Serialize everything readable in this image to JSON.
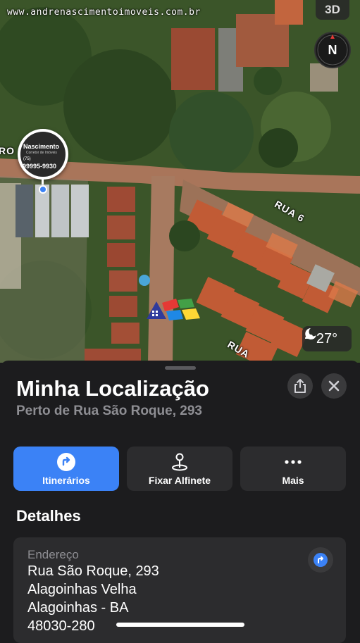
{
  "map": {
    "watermark": "www.andrenascimentoimoveis.com.br",
    "mode_button": "3D",
    "compass_letter": "N",
    "street_labels": [
      "RO",
      "RUA 6",
      "RUA"
    ],
    "pin": {
      "title": "Nascimento",
      "subtitle": "Corretor de Imóveis",
      "phone": "99995-9930",
      "prefix": "(75)"
    },
    "weather": {
      "icon": "moon-cloud-icon",
      "temperature": "27°"
    },
    "logo_colors": [
      "#2f3a9c",
      "#e53935",
      "#43a047",
      "#1e88e5",
      "#fdd835"
    ]
  },
  "sheet": {
    "title": "Minha Localização",
    "subtitle": "Perto de Rua São Roque, 293",
    "actions": [
      {
        "label": "Itinerários",
        "icon": "directions-icon"
      },
      {
        "label": "Fixar Alfinete",
        "icon": "pin-icon"
      },
      {
        "label": "Mais",
        "icon": "more-icon"
      }
    ],
    "details_heading": "Detalhes",
    "address": {
      "label": "Endereço",
      "lines": [
        "Rua São Roque, 293",
        "Alagoinhas Velha",
        "Alagoinhas - BA",
        "48030-280"
      ]
    }
  },
  "colors": {
    "accent": "#3b82f6",
    "sheet_bg": "#1c1c1e",
    "card_bg": "#2c2c2e",
    "secondary_text": "#8e8e93"
  }
}
